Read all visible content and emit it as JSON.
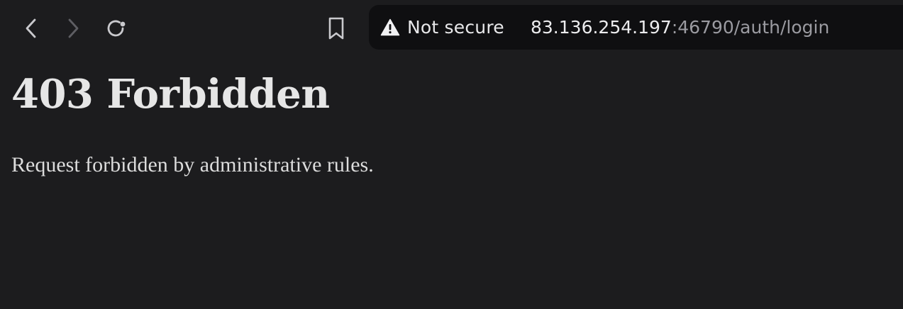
{
  "browser": {
    "toolbar": {
      "back_icon": "chevron-left-icon",
      "forward_icon": "chevron-right-icon",
      "reload_icon": "reload-icon",
      "bookmark_icon": "bookmark-icon"
    },
    "omnibox": {
      "security_icon": "warning-triangle-icon",
      "security_label": "Not secure",
      "url_host": "83.136.254.197",
      "url_rest": ":46790/auth/login"
    },
    "colors": {
      "background": "#1c1c1e",
      "omnibox_background": "#0f0f11",
      "text_primary": "#ececee",
      "text_muted": "#9b9ba1"
    }
  },
  "page": {
    "title": "403 Forbidden",
    "message": "Request forbidden by administrative rules."
  }
}
